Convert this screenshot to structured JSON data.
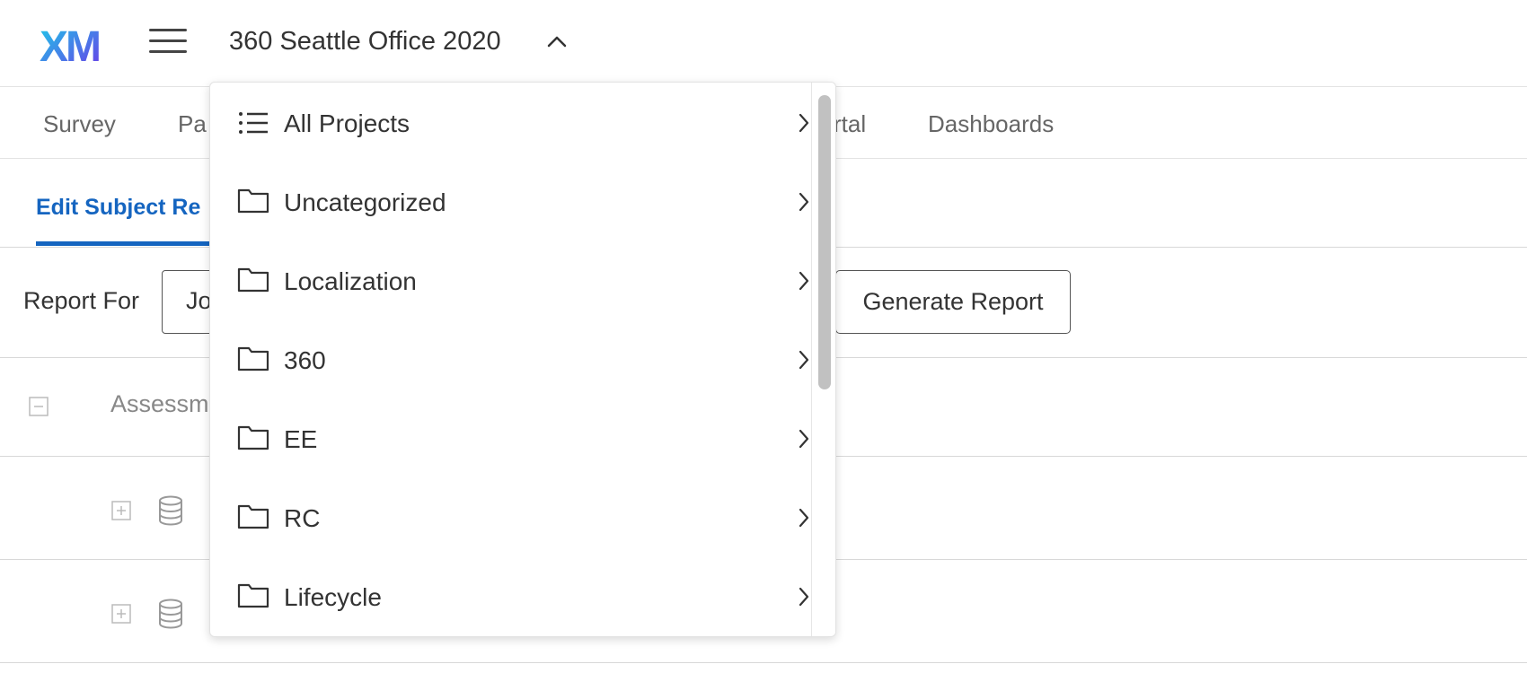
{
  "header": {
    "logo_text": "XM",
    "project_title": "360 Seattle Office 2020"
  },
  "nav": {
    "items": [
      {
        "label": "Survey"
      },
      {
        "label": "Pa"
      },
      {
        "label": "rtal"
      },
      {
        "label": "Dashboards"
      }
    ]
  },
  "subnav": {
    "active_tab": "Edit Subject Re"
  },
  "report": {
    "label": "Report For",
    "select_value": "Jo",
    "generate_label": "Generate Report"
  },
  "table": {
    "header_label": "Assessm"
  },
  "dropdown": {
    "items": [
      {
        "label": "All Projects",
        "icon": "list-icon"
      },
      {
        "label": "Uncategorized",
        "icon": "folder-icon"
      },
      {
        "label": "Localization",
        "icon": "folder-icon"
      },
      {
        "label": "360",
        "icon": "folder-icon"
      },
      {
        "label": "EE",
        "icon": "folder-icon"
      },
      {
        "label": "RC",
        "icon": "folder-icon"
      },
      {
        "label": "Lifecycle",
        "icon": "folder-icon"
      }
    ]
  },
  "colors": {
    "accent": "#1565c0",
    "logo_gradient_start": "#1ec8e8",
    "logo_gradient_end": "#6a3de8"
  }
}
